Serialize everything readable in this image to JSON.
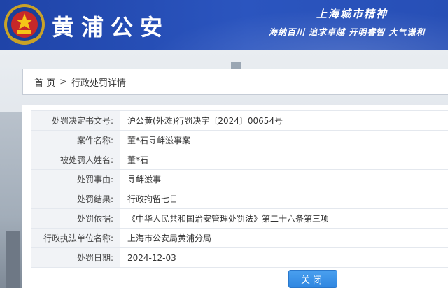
{
  "header": {
    "site_title": "黄浦公安",
    "slogan_title": "上海城市精神",
    "slogan_line": "海纳百川  追求卓越  开明睿智  大气谦和",
    "emblem_icon": "police-emblem-icon"
  },
  "breadcrumb": {
    "home": "首 页",
    "separator": ">",
    "current": "行政处罚详情"
  },
  "details": [
    {
      "label": "处罚决定书文号:",
      "value": "沪公黄(外滩)行罚决字〔2024〕00654号"
    },
    {
      "label": "案件名称:",
      "value": "董*石寻衅滋事案"
    },
    {
      "label": "被处罚人姓名:",
      "value": "董*石"
    },
    {
      "label": "处罚事由:",
      "value": "寻衅滋事"
    },
    {
      "label": "处罚结果:",
      "value": "行政拘留七日"
    },
    {
      "label": "处罚依据:",
      "value": "《中华人民共和国治安管理处罚法》第二十六条第三项"
    },
    {
      "label": "行政执法单位名称:",
      "value": "上海市公安局黄浦分局"
    },
    {
      "label": "处罚日期:",
      "value": "2024-12-03"
    }
  ],
  "actions": {
    "close_label": "关闭"
  },
  "colors": {
    "header_blue": "#2b55bf",
    "button_blue": "#3a92e8",
    "label_bg": "#f1f3f6"
  }
}
